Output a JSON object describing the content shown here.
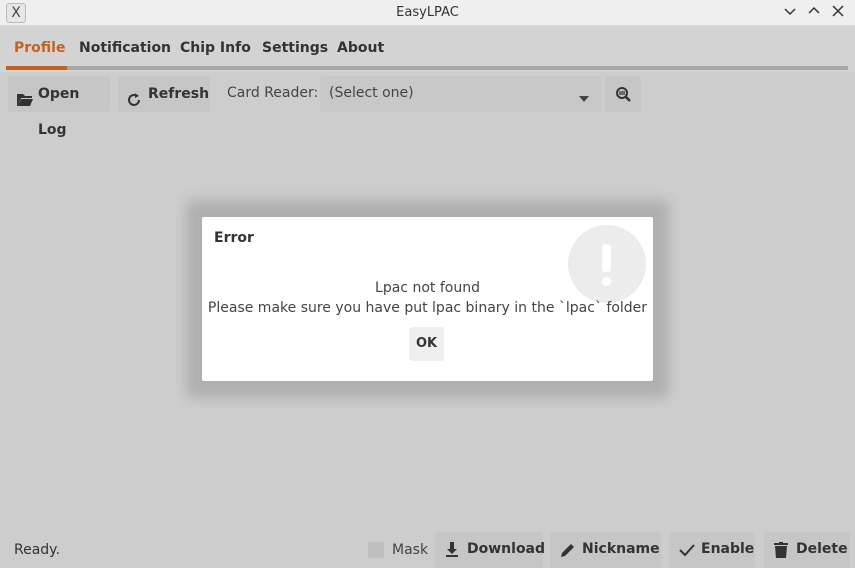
{
  "window": {
    "title": "EasyLPAC"
  },
  "tabs": [
    {
      "label": "Profile",
      "active": true
    },
    {
      "label": "Notification"
    },
    {
      "label": "Chip Info"
    },
    {
      "label": "Settings"
    },
    {
      "label": "About"
    }
  ],
  "toolbar": {
    "open_log": "Open Log",
    "refresh": "Refresh",
    "card_reader_label": "Card Reader:",
    "card_reader_value": "(Select one)"
  },
  "dialog": {
    "title": "Error",
    "line1": "Lpac not found",
    "line2": "Please make sure you have put lpac binary in the `lpac` folder",
    "ok": "OK"
  },
  "status": {
    "text": "Ready."
  },
  "actions": {
    "mask": "Mask",
    "download": "Download",
    "nickname": "Nickname",
    "enable": "Enable",
    "delete": "Delete"
  },
  "colors": {
    "accent": "#c5621c",
    "background": "#cdcdcd",
    "dialog": "#ffffff"
  }
}
